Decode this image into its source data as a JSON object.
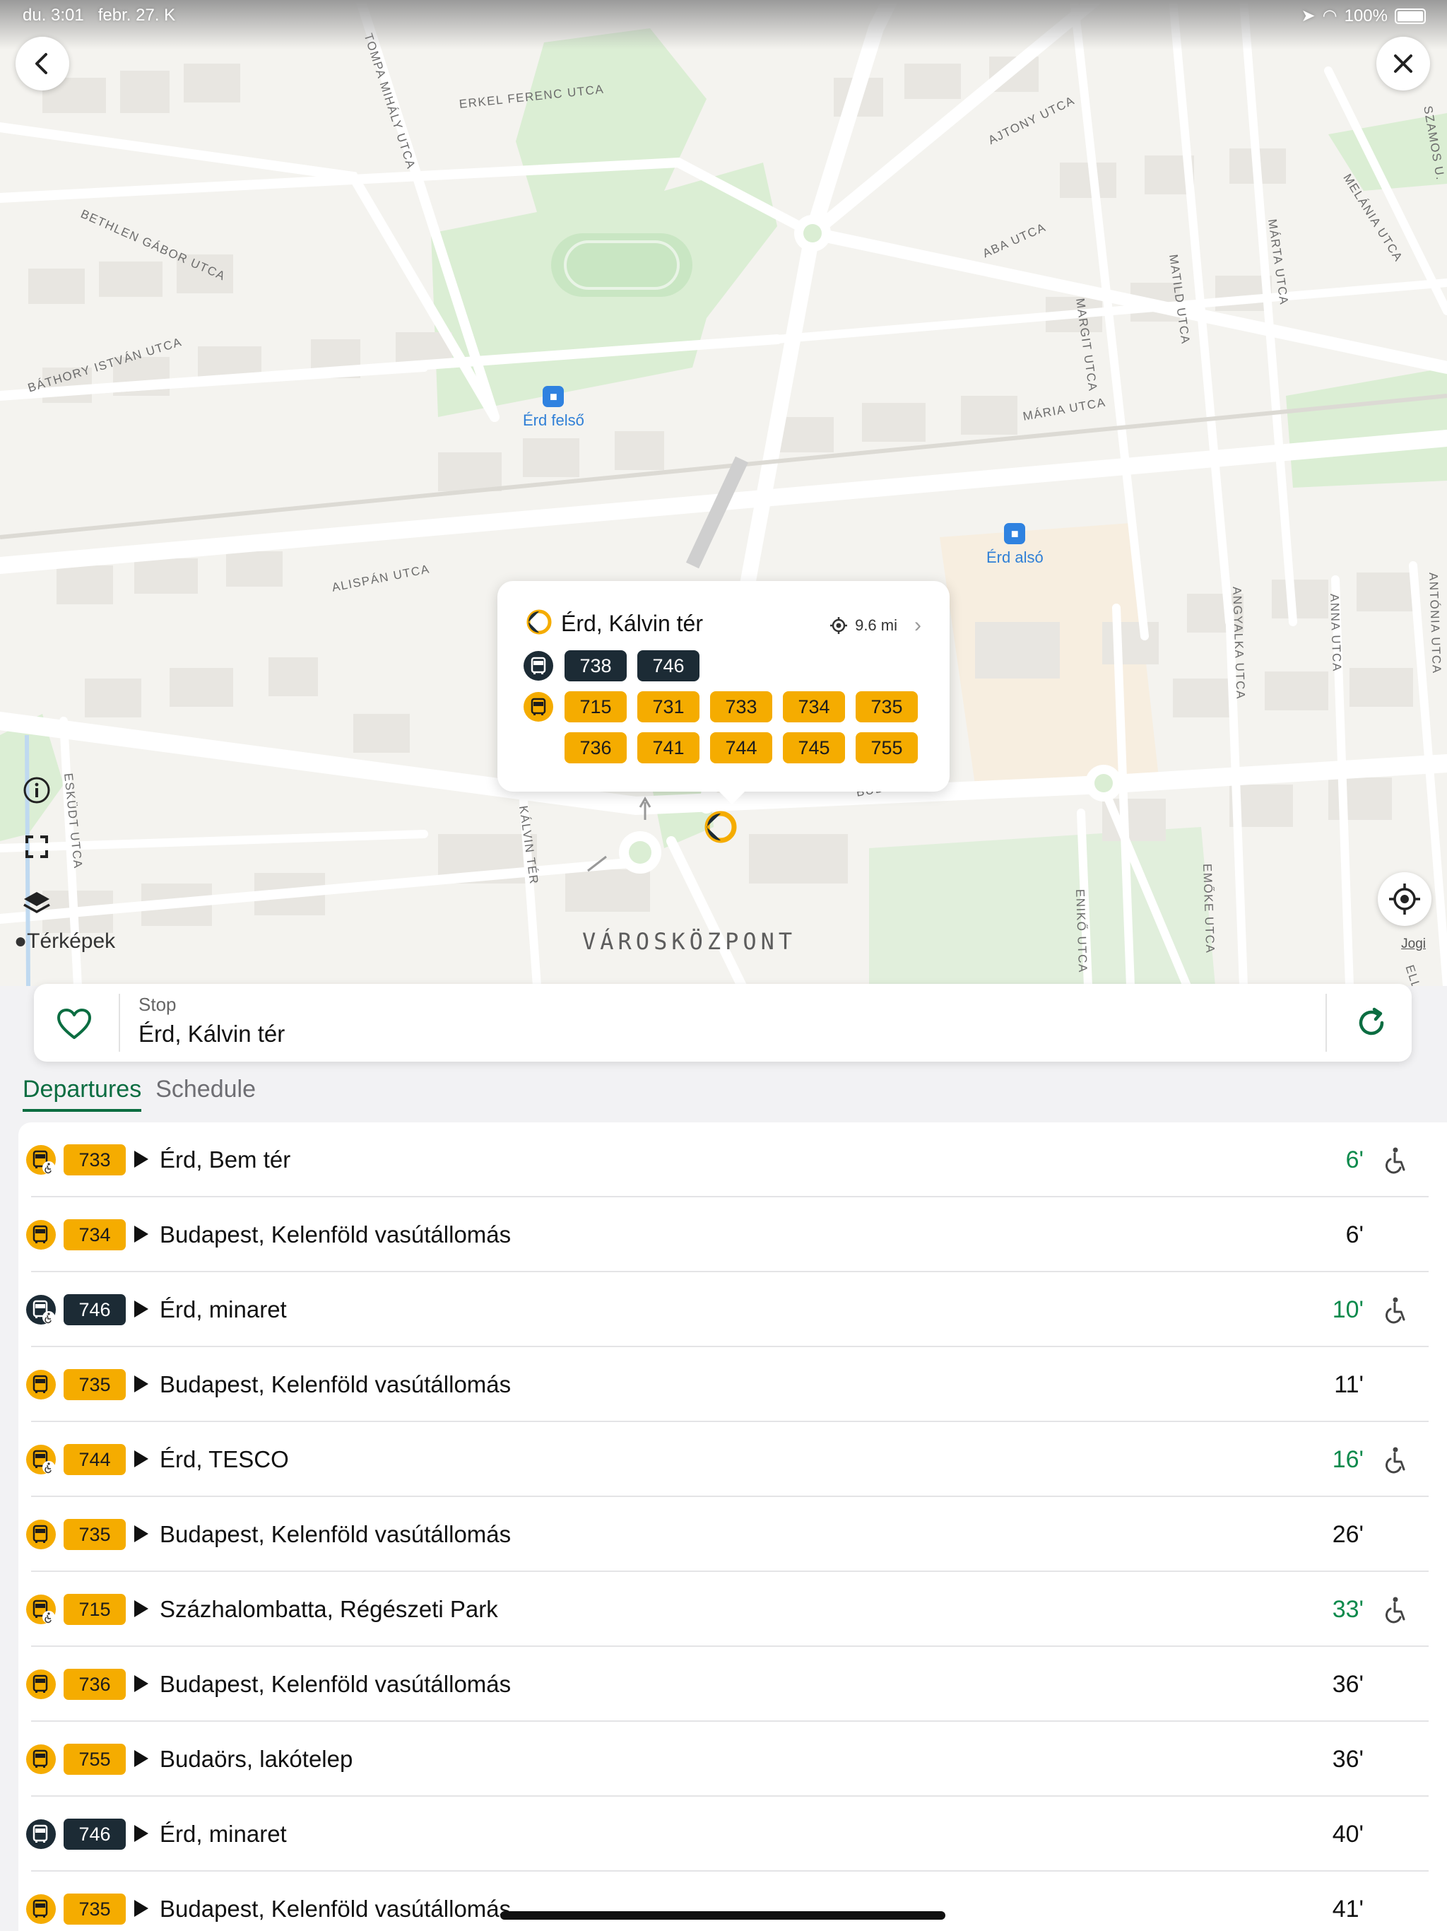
{
  "status_bar": {
    "time": "du. 3:01",
    "date": "febr. 27. K",
    "battery": "100%"
  },
  "map": {
    "district": "VÁROSKÖZPONT",
    "attribution": "Térképek",
    "legal": "Jogi",
    "streets": {
      "tompa": "TOMPA MIHÁLY UTCA",
      "erkel": "ERKEL FERENC UTCA",
      "ajtony": "AJTONY UTCA",
      "szamos": "SZAMOS U.",
      "melania": "MELÁNIA UTCA",
      "bethlen": "BETHLEN GÁBOR UTCA",
      "aba": "ABA UTCA",
      "matild": "MATILD UTCA",
      "marta": "MÁRTA UTCA",
      "margit": "MARGIT UTCA",
      "bathory": "BÁTHORY ISTVÁN UTCA",
      "maria": "MÁRIA UTCA",
      "alispan": "ALISPÁN UTCA",
      "angyalka": "ANGYALKA UTCA",
      "anna": "ANNA UTCA",
      "antonia": "ANTÓNIA UTCA",
      "eskudt": "ESKÜDT UTCA",
      "kalvin": "KÁLVIN TÉR",
      "buda": "BUDA",
      "eniko": "ENIKŐ UTCA",
      "emoke": "EMŐKE UTCA",
      "ella": "ELLA UTCA"
    },
    "stations": {
      "felso": "Érd felső",
      "also": "Érd alsó"
    }
  },
  "popup": {
    "stop_name": "Érd, Kálvin tér",
    "distance": "9.6 mi",
    "dark_routes": [
      "738",
      "746"
    ],
    "yellow_routes_row1": [
      "715",
      "731",
      "733",
      "734",
      "735"
    ],
    "yellow_routes_row2": [
      "736",
      "741",
      "744",
      "745",
      "755"
    ]
  },
  "stop_bar": {
    "kind": "Stop",
    "name": "Érd, Kálvin tér"
  },
  "tabs": {
    "departures": "Departures",
    "schedule": "Schedule"
  },
  "departures": [
    {
      "route": "733",
      "style": "yel",
      "dest": "Érd, Bem tér",
      "time": "6'",
      "realtime": true,
      "accessible": true
    },
    {
      "route": "734",
      "style": "yel",
      "dest": "Budapest, Kelenföld vasútállomás",
      "time": "6'",
      "realtime": false,
      "accessible": false
    },
    {
      "route": "746",
      "style": "dark",
      "dest": "Érd, minaret",
      "time": "10'",
      "realtime": true,
      "accessible": true
    },
    {
      "route": "735",
      "style": "yel",
      "dest": "Budapest, Kelenföld vasútállomás",
      "time": "11'",
      "realtime": false,
      "accessible": false
    },
    {
      "route": "744",
      "style": "yel",
      "dest": "Érd, TESCO",
      "time": "16'",
      "realtime": true,
      "accessible": true
    },
    {
      "route": "735",
      "style": "yel",
      "dest": "Budapest, Kelenföld vasútállomás",
      "time": "26'",
      "realtime": false,
      "accessible": false
    },
    {
      "route": "715",
      "style": "yel",
      "dest": "Százhalombatta, Régészeti Park",
      "time": "33'",
      "realtime": true,
      "accessible": true
    },
    {
      "route": "736",
      "style": "yel",
      "dest": "Budapest, Kelenföld vasútállomás",
      "time": "36'",
      "realtime": false,
      "accessible": false
    },
    {
      "route": "755",
      "style": "yel",
      "dest": "Budaörs, lakótelep",
      "time": "36'",
      "realtime": false,
      "accessible": false
    },
    {
      "route": "746",
      "style": "dark",
      "dest": "Érd, minaret",
      "time": "40'",
      "realtime": false,
      "accessible": false
    },
    {
      "route": "735",
      "style": "yel",
      "dest": "Budapest, Kelenföld vasútállomás",
      "time": "41'",
      "realtime": false,
      "accessible": false
    }
  ],
  "colors": {
    "accent_green": "#0b6d41",
    "realtime_green": "#0b8a4c",
    "route_yellow": "#f5ac00",
    "route_dark": "#1c2b35"
  },
  "icons": {
    "back": "chevron-left-icon",
    "close": "close-icon",
    "info": "info-icon",
    "expand": "expand-icon",
    "layers": "layers-icon",
    "locate": "crosshair-icon",
    "favorite": "heart-icon",
    "refresh": "refresh-icon",
    "bus": "bus-icon",
    "wheelchair": "wheelchair-icon",
    "play": "play-icon"
  }
}
